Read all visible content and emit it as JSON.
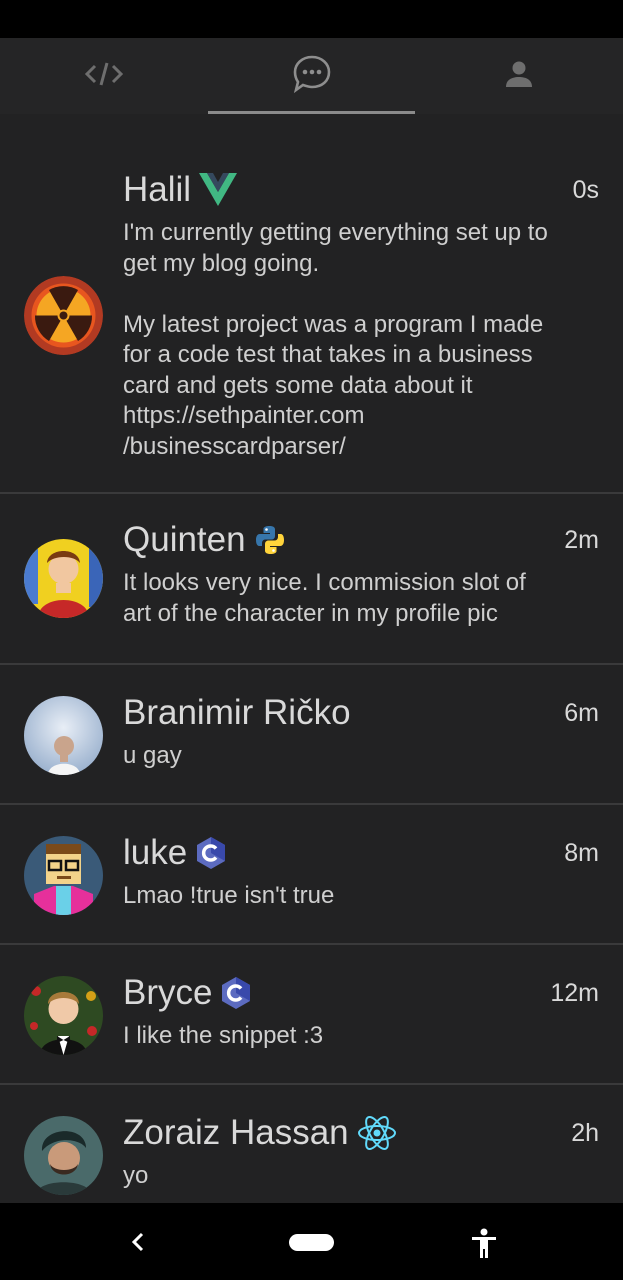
{
  "tabs": [
    {
      "icon": "code-icon"
    },
    {
      "icon": "chat-bubble-icon",
      "active": true
    },
    {
      "icon": "person-icon"
    }
  ],
  "posts": [
    {
      "name": "Halil",
      "badge": "vue-icon",
      "time": "0s",
      "message": "I'm currently getting everything set up to\nget my blog going.\n\nMy latest project was a program I made\nfor a code test that takes in a business\ncard and gets some data about it\nhttps://sethpainter.com\n/businesscardparser/"
    },
    {
      "name": "Quinten",
      "badge": "python-icon",
      "time": "2m",
      "message": "It looks very nice. I commission slot of\nart of the character in my profile pic"
    },
    {
      "name": "Branimir Ričko",
      "badge": "",
      "time": "6m",
      "message": "u gay"
    },
    {
      "name": "luke",
      "badge": "c-language-icon",
      "time": "8m",
      "message": "Lmao !true isn't true"
    },
    {
      "name": "Bryce",
      "badge": "c-language-icon",
      "time": "12m",
      "message": "I like the snippet :3"
    },
    {
      "name": "Zoraiz Hassan",
      "badge": "react-icon",
      "time": "2h",
      "message": "yo"
    }
  ],
  "colors": {
    "background": "#222223",
    "tab_bar": "#252526",
    "vue_green": "#41b883",
    "python_blue": "#3776ab",
    "python_yellow": "#ffd43b",
    "c_purple": "#5c6bc0",
    "react_blue": "#61dafb"
  }
}
